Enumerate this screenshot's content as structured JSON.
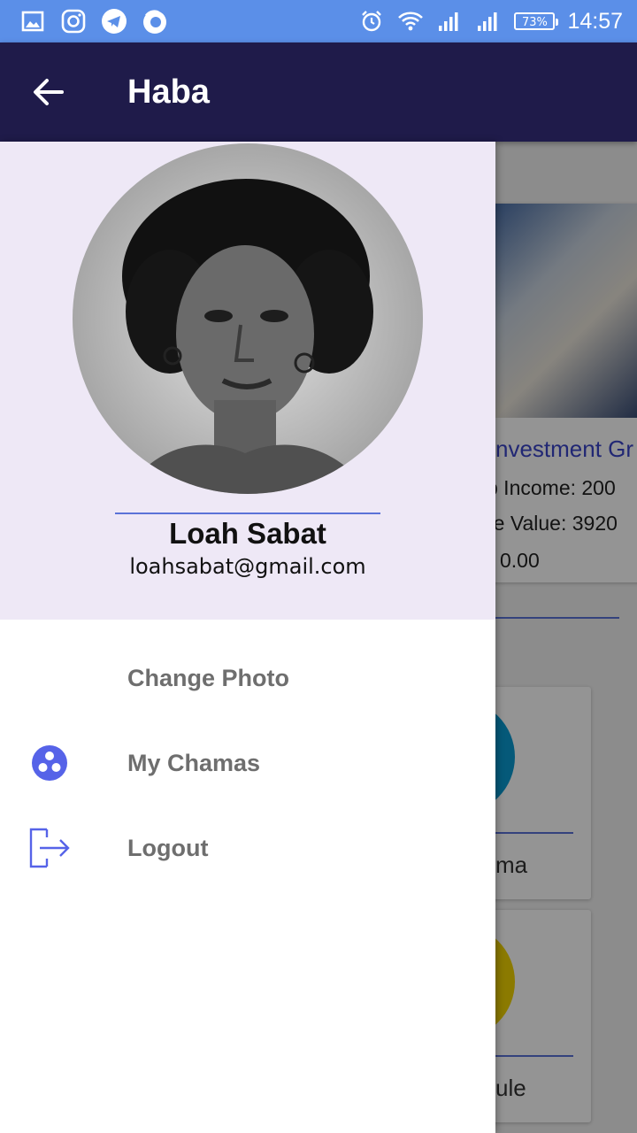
{
  "status_bar": {
    "battery": "73%",
    "time": "14:57",
    "left_icons": [
      "gallery-icon",
      "instagram-icon",
      "telegram-icon",
      "firefox-icon"
    ],
    "right_icons": [
      "alarm-icon",
      "wifi-icon",
      "signal-icon",
      "signal-icon",
      "battery-icon"
    ]
  },
  "app_bar": {
    "title": "Haba",
    "back_icon": "arrow-left-icon"
  },
  "drawer": {
    "user": {
      "name": "Loah Sabat",
      "email": "loahsabat@gmail.com"
    },
    "menu": [
      {
        "label": "Change Photo",
        "icon": ""
      },
      {
        "label": "My Chamas",
        "icon": "group-dots-icon"
      },
      {
        "label": "Logout",
        "icon": "logout-icon"
      }
    ]
  },
  "background": {
    "group_title": "nvestment Gr",
    "lines": [
      "p Income:  200",
      "re Value:  3920",
      "0.00"
    ],
    "tile_labels": [
      "ma",
      "ule"
    ]
  },
  "colors": {
    "status_bar": "#5b8fe8",
    "app_bar": "#1f1b4a",
    "drawer_header": "#eee8f6",
    "accent": "#5b72d8",
    "menu_text": "#6e6e6e"
  }
}
